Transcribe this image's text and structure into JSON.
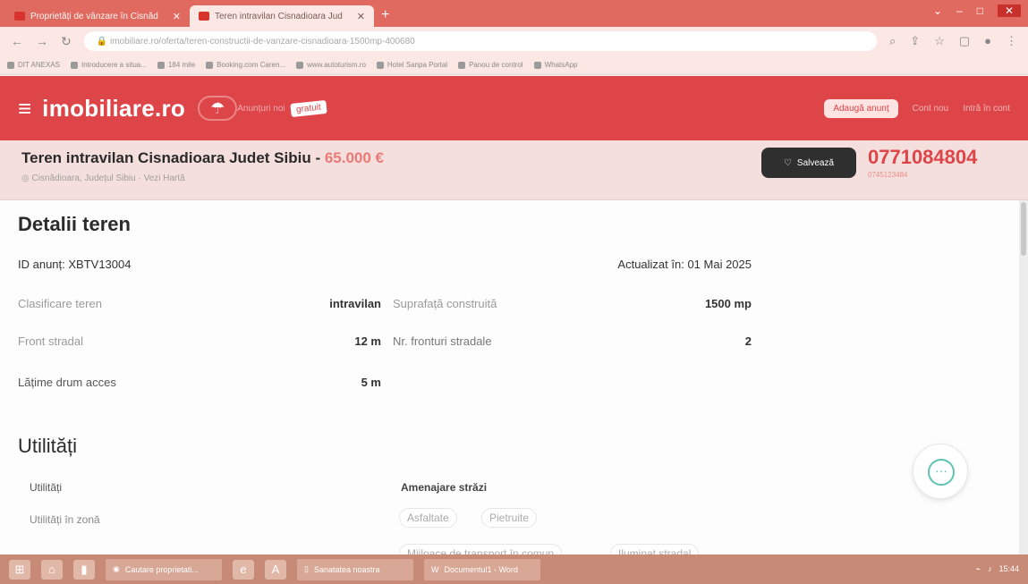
{
  "browser": {
    "tabs": [
      {
        "title": "Proprietăți de vânzare în Cisnăd",
        "active": false
      },
      {
        "title": "Teren intravilan Cisnadioara Jud",
        "active": true
      }
    ],
    "new_tab": "+",
    "url": "imobiliare.ro/oferta/teren-constructii-de-vanzare-cisnadioara-1500mp-400680",
    "bookmarks": [
      "DIT ANEXAS",
      "Introducere a situa...",
      "184 mile",
      "Booking.com Caren...",
      "www.autoturism.ro",
      "Hotel Sanpa Portal",
      "Panou de control",
      "WhatsApp"
    ]
  },
  "site": {
    "logo": "imobiliare.ro",
    "header_link": "Anunțuri noi",
    "promo": "gratuit",
    "add_listing": "Adaugă anunț",
    "account_links": [
      "Cont nou",
      "Intră în cont"
    ]
  },
  "listing": {
    "title": "Teren intravilan Cisnadioara Judet Sibiu",
    "separator": " - ",
    "price": "65.000 €",
    "location": "Cisnădioara, Județul Sibiu · Vezi Hartă",
    "save_label": "Salvează",
    "phone": "0771084804",
    "phone_secondary": "0745123484"
  },
  "details": {
    "heading": "Detalii teren",
    "id_label": "ID anunț: XBTV13004",
    "updated": "Actualizat în: 01 Mai 2025",
    "rows": [
      {
        "label": "Clasificare teren",
        "value": "intravilan"
      },
      {
        "label": "Suprafață construită",
        "value": "1500 mp"
      },
      {
        "label": "Front stradal",
        "value": "12 m"
      },
      {
        "label": "Nr. fronturi stradale",
        "value": "2"
      },
      {
        "label": "Lățime drum acces",
        "value": "5 m"
      }
    ]
  },
  "utilities": {
    "heading": "Utilități",
    "col1_title": "Utilități",
    "col1_item": "Utilități în zonă",
    "col2_title": "Amenajare străzi",
    "chips": [
      "Asfaltate",
      "Pietruite",
      "Mijloace de transport în comun",
      "Iluminat stradal"
    ]
  },
  "chat": {
    "icon": "chat-icon",
    "glyph": "···"
  },
  "taskbar": {
    "apps": [
      "Cautare proprietati...",
      "Sanatatea noastra",
      "Documentul1 - Word"
    ],
    "tray": "15:44"
  },
  "colors": {
    "brand": "#de4549",
    "price": "#e97a77",
    "chat_accent": "#5ec3b4"
  }
}
